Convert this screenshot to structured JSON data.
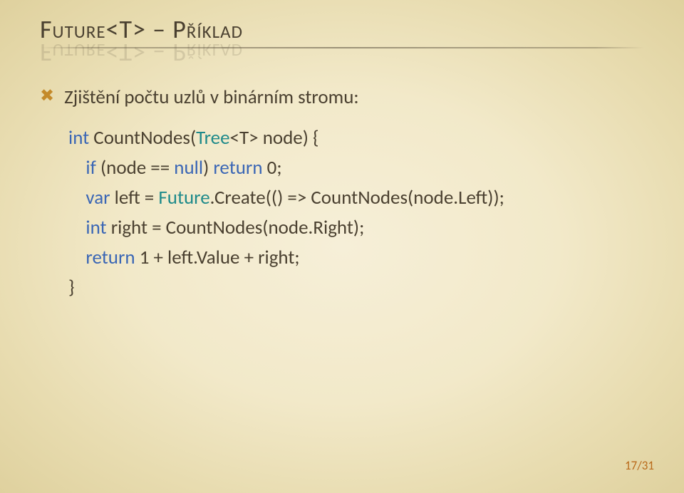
{
  "title": "Future<T> – Příklad",
  "bullet": "Zjištění počtu uzlů v binárním stromu:",
  "code": {
    "l1_kw_int": "int",
    "l1_rest": " CountNodes(",
    "l1_tree": "Tree",
    "l1_rest2": "<T> node) {",
    "l2_if": "if",
    "l2_mid": " (node == ",
    "l2_null": "null",
    "l2_mid2": ") ",
    "l2_return": "return",
    "l2_end": " 0;",
    "l3_var": "var",
    "l3_mid": " left = ",
    "l3_future": "Future",
    "l3_end": ".Create(() => CountNodes(node.Left));",
    "l4_int": "int",
    "l4_end": " right = CountNodes(node.Right);",
    "l5_return": "return",
    "l5_end": " 1 + left.Value + right;",
    "l6": "}"
  },
  "pageNumber": "17/31"
}
